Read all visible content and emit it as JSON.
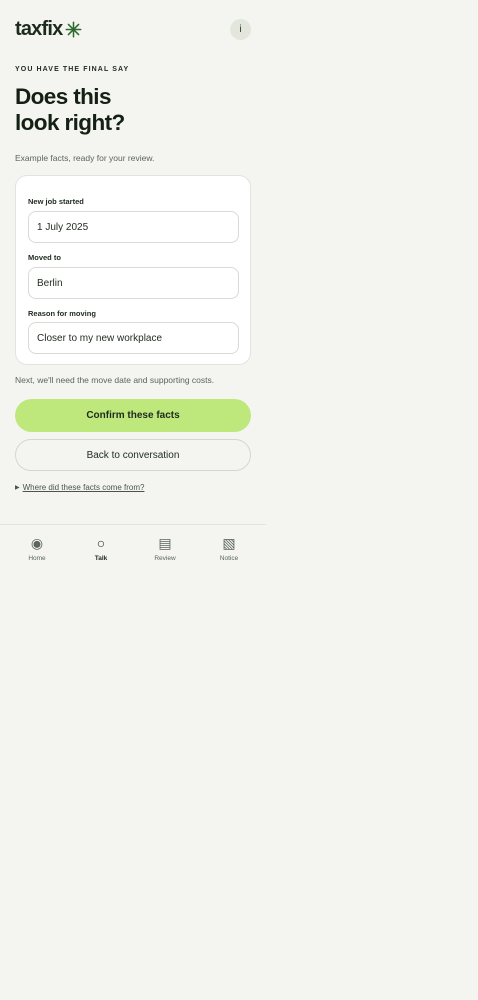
{
  "header": {
    "logo_text": "taxfix",
    "info_label": "i"
  },
  "main": {
    "eyebrow": "YOU HAVE THE FINAL SAY",
    "title_line1": "Does this",
    "title_line2": "look right?",
    "subtitle": "Example facts, ready for your review."
  },
  "facts": [
    {
      "label": "New job started",
      "value": "1 July 2025"
    },
    {
      "label": "Moved to",
      "value": "Berlin"
    },
    {
      "label": "Reason for moving",
      "value": "Closer to my new workplace"
    }
  ],
  "next_note": "Next, we'll need the move date and supporting costs.",
  "actions": {
    "confirm_label": "Confirm these facts",
    "back_label": "Back to conversation",
    "disclosure_arrow": "▶",
    "disclosure_label": "Where did these facts come from?"
  },
  "nav": {
    "active": "talk",
    "items": [
      {
        "label": "Home",
        "glyph": "◉",
        "icon": "home-icon"
      },
      {
        "label": "Talk",
        "glyph": "○",
        "icon": "talk-icon"
      },
      {
        "label": "Review",
        "glyph": "▤",
        "icon": "review-icon"
      },
      {
        "label": "Notice",
        "glyph": "▧",
        "icon": "notice-icon"
      }
    ]
  },
  "colors": {
    "background": "#f4f5f0",
    "accent": "#bfe87c",
    "logo_star": "#2e6a2e",
    "text": "#1f2a1f"
  }
}
